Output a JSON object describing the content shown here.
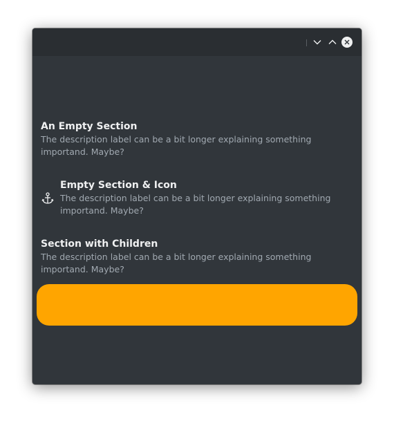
{
  "window": {
    "controls": {
      "minimize_icon": "chevron-down-icon",
      "maximize_icon": "chevron-up-icon",
      "close_icon": "close-icon"
    }
  },
  "sections": [
    {
      "title": "An Empty Section",
      "description": "The description label can be a bit longer explaining something importand. Maybe?"
    },
    {
      "title": "Empty Section & Icon",
      "description": "The description label can be a bit longer explaining something importand. Maybe?",
      "icon": "anchor-icon"
    },
    {
      "title": "Section with Children",
      "description": "The description label can be a bit longer explaining something importand. Maybe?",
      "child_color": "#ffa500"
    }
  ]
}
